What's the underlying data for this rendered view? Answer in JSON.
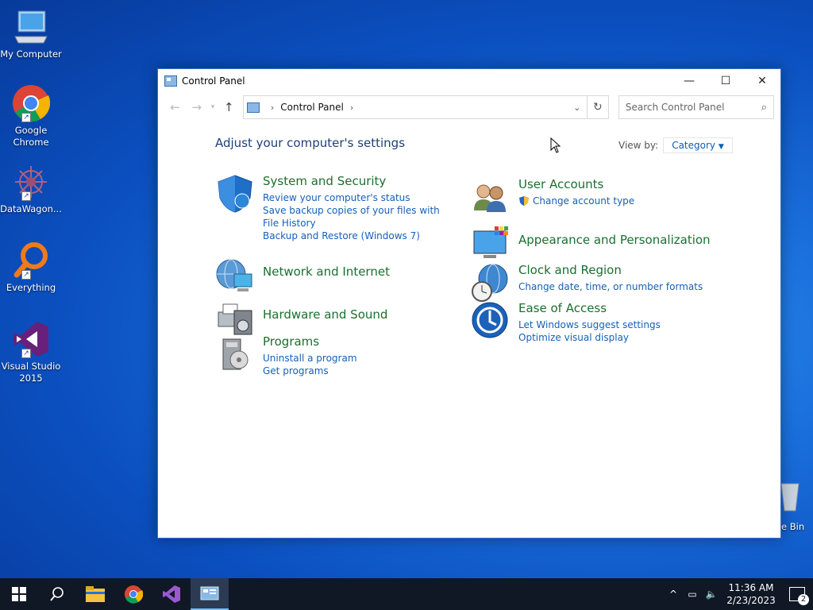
{
  "desktop": {
    "icons": [
      {
        "label": "My Computer"
      },
      {
        "label": "Google Chrome"
      },
      {
        "label": "DataWagon..."
      },
      {
        "label": "Everything"
      },
      {
        "label": "Visual Studio 2015"
      }
    ],
    "recycle_label": "e Bin"
  },
  "window": {
    "title": "Control Panel",
    "controls": {
      "minimize": "—",
      "maximize": "☐",
      "close": "✕"
    }
  },
  "addressbar": {
    "path": "Control Panel",
    "search_placeholder": "Search Control Panel"
  },
  "content": {
    "heading": "Adjust your computer's settings",
    "view_by_label": "View by:",
    "view_by_value": "Category",
    "categories_left": [
      {
        "title": "System and Security",
        "links": [
          "Review your computer's status",
          "Save backup copies of your files with File History",
          "Backup and Restore (Windows 7)"
        ]
      },
      {
        "title": "Network and Internet",
        "links": []
      },
      {
        "title": "Hardware and Sound",
        "links": []
      },
      {
        "title": "Programs",
        "links": [
          "Uninstall a program",
          "Get programs"
        ]
      }
    ],
    "categories_right": [
      {
        "title": "User Accounts",
        "links": [
          "Change account type"
        ]
      },
      {
        "title": "Appearance and Personalization",
        "links": []
      },
      {
        "title": "Clock and Region",
        "links": [
          "Change date, time, or number formats"
        ]
      },
      {
        "title": "Ease of Access",
        "links": [
          "Let Windows suggest settings",
          "Optimize visual display"
        ]
      }
    ]
  },
  "taskbar": {
    "time": "11:36 AM",
    "date": "2/23/2023",
    "notification_count": "2"
  },
  "colors": {
    "category_title": "#1b6f2e",
    "link": "#1560b8",
    "heading": "#1e3f7a"
  }
}
